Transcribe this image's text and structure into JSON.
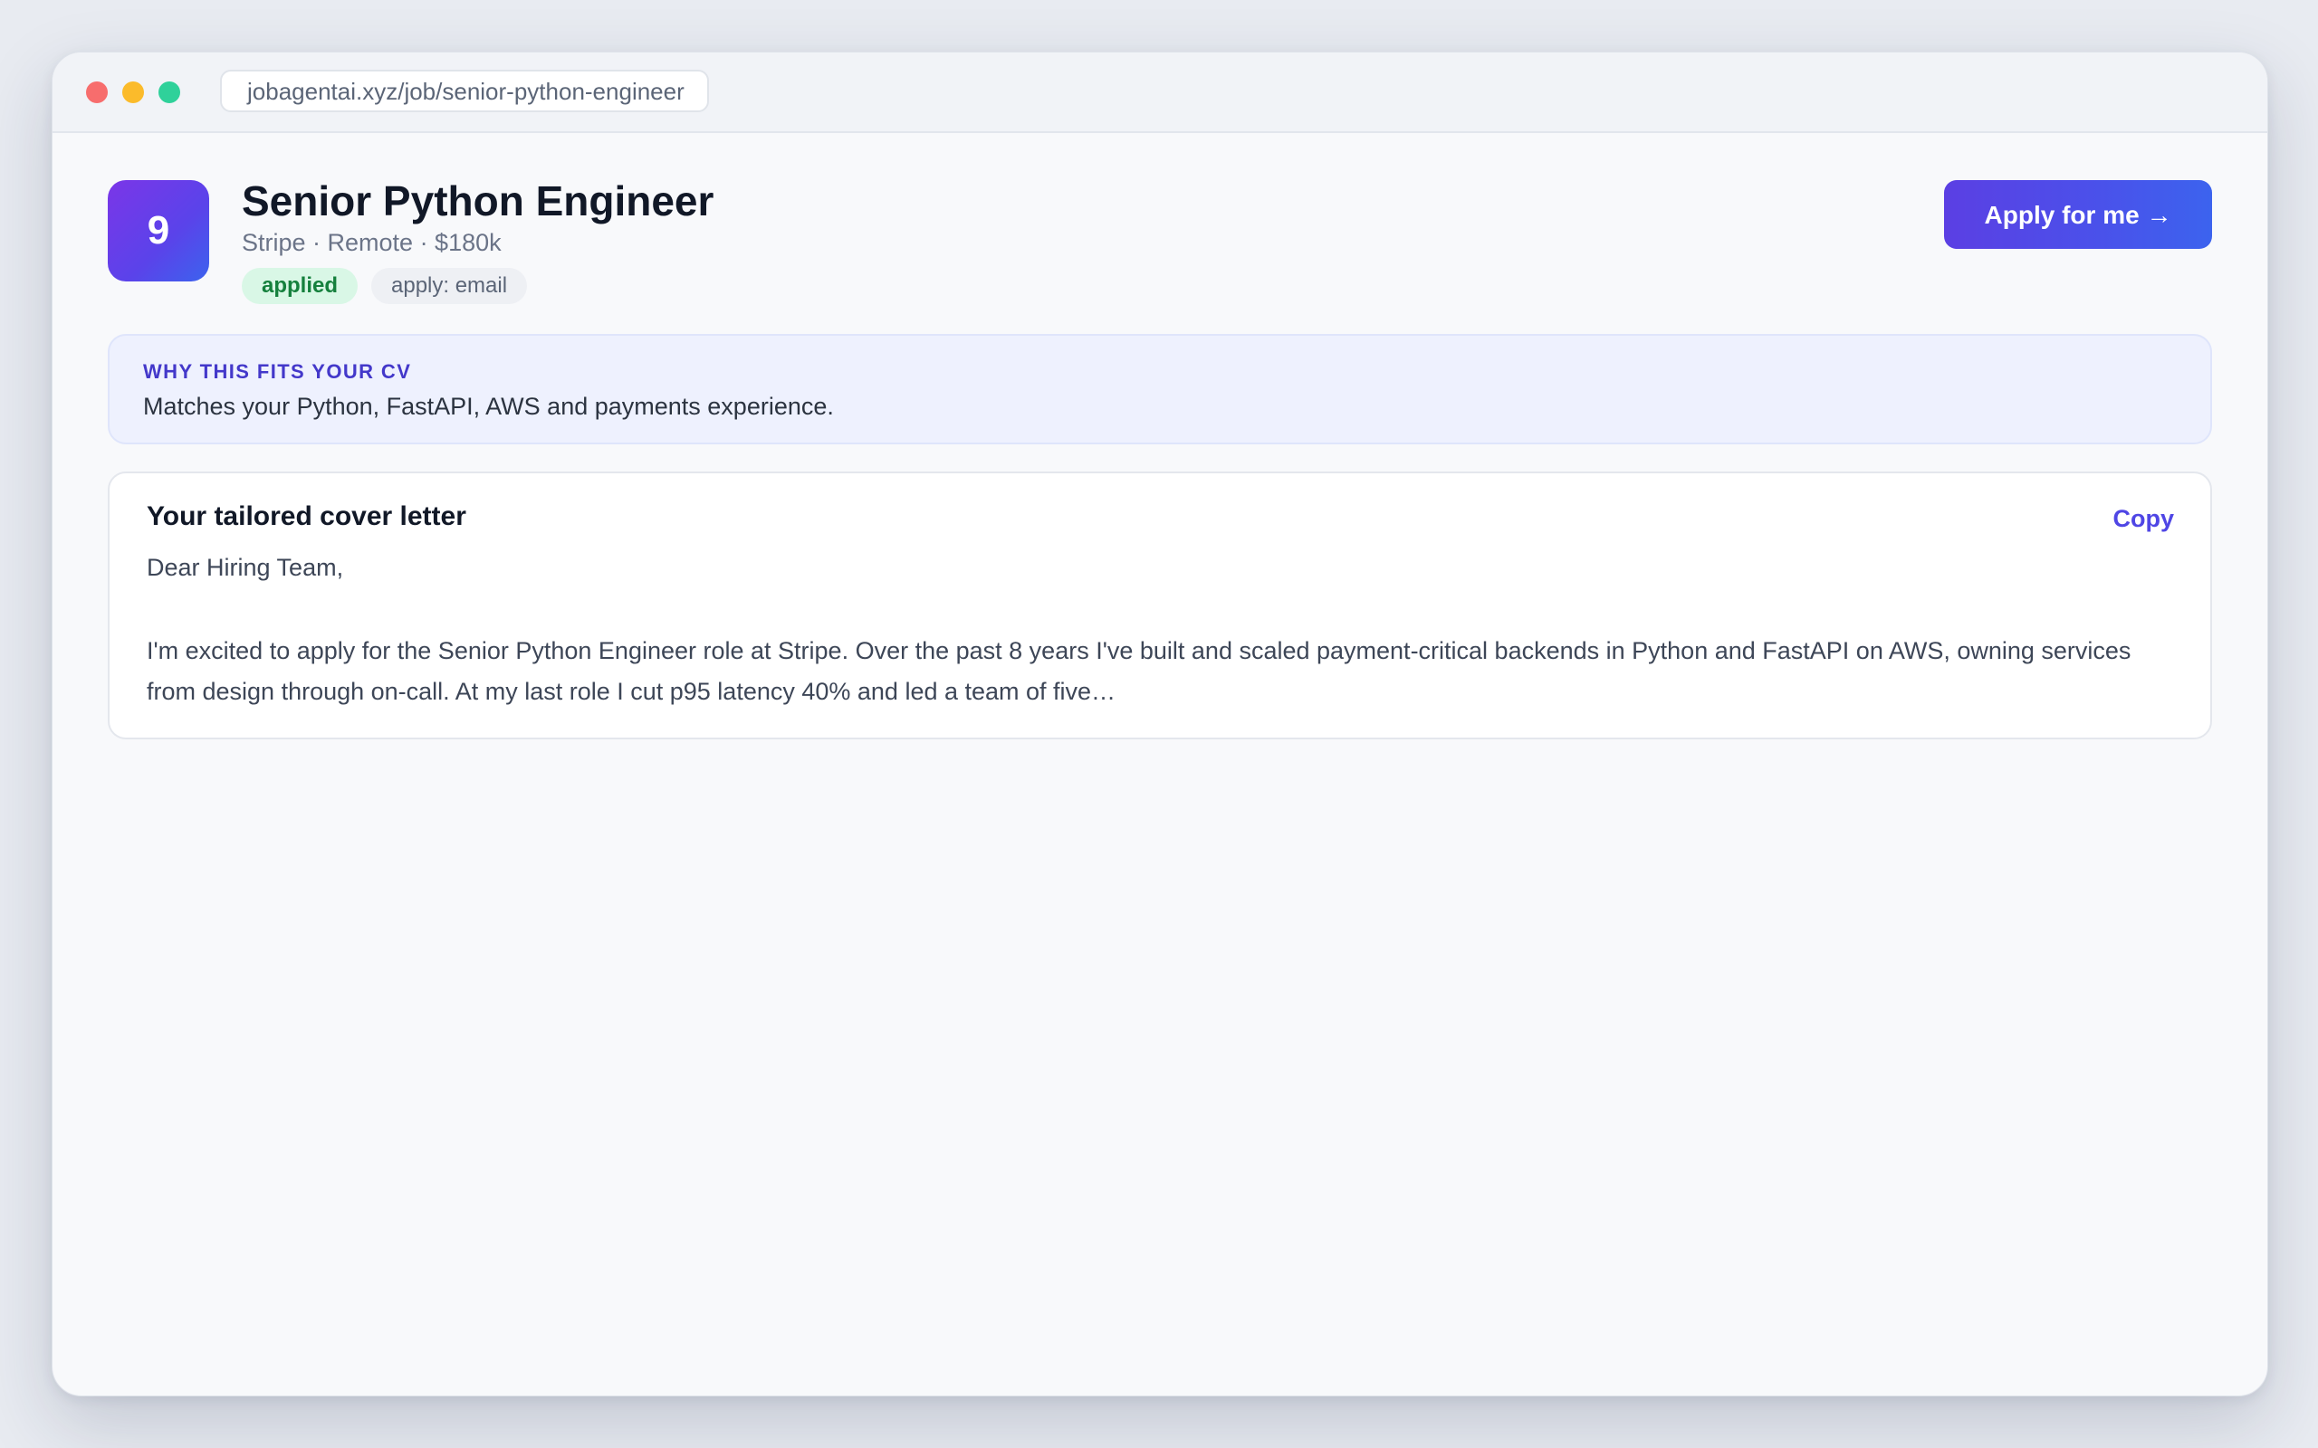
{
  "browser": {
    "url": "jobagentai.xyz/job/senior-python-engineer"
  },
  "job": {
    "score": "9",
    "title": "Senior Python Engineer",
    "meta": "Stripe · Remote · $180k",
    "status_badge": "applied",
    "apply_method_badge": "apply: email",
    "apply_button": "Apply for me →"
  },
  "fit": {
    "label": "WHY THIS FITS YOUR CV",
    "text": "Matches your Python, FastAPI, AWS and payments experience."
  },
  "cover_letter": {
    "title": "Your tailored cover letter",
    "copy_button": "Copy",
    "greeting": "Dear Hiring Team,",
    "body": "I'm excited to apply for the Senior Python Engineer role at Stripe. Over the past 8 years I've built and scaled payment-critical backends in Python and FastAPI on AWS, owning services from design through on-call. At my last role I cut p95 latency 40% and led a team of five…"
  },
  "colors": {
    "accent": "#4f46e5",
    "gradient_start": "#7b36e8",
    "gradient_end": "#3c63ee",
    "applied_badge_bg": "#d9f7e6",
    "applied_badge_text": "#15803d",
    "fit_box_bg": "#eef1fe"
  }
}
